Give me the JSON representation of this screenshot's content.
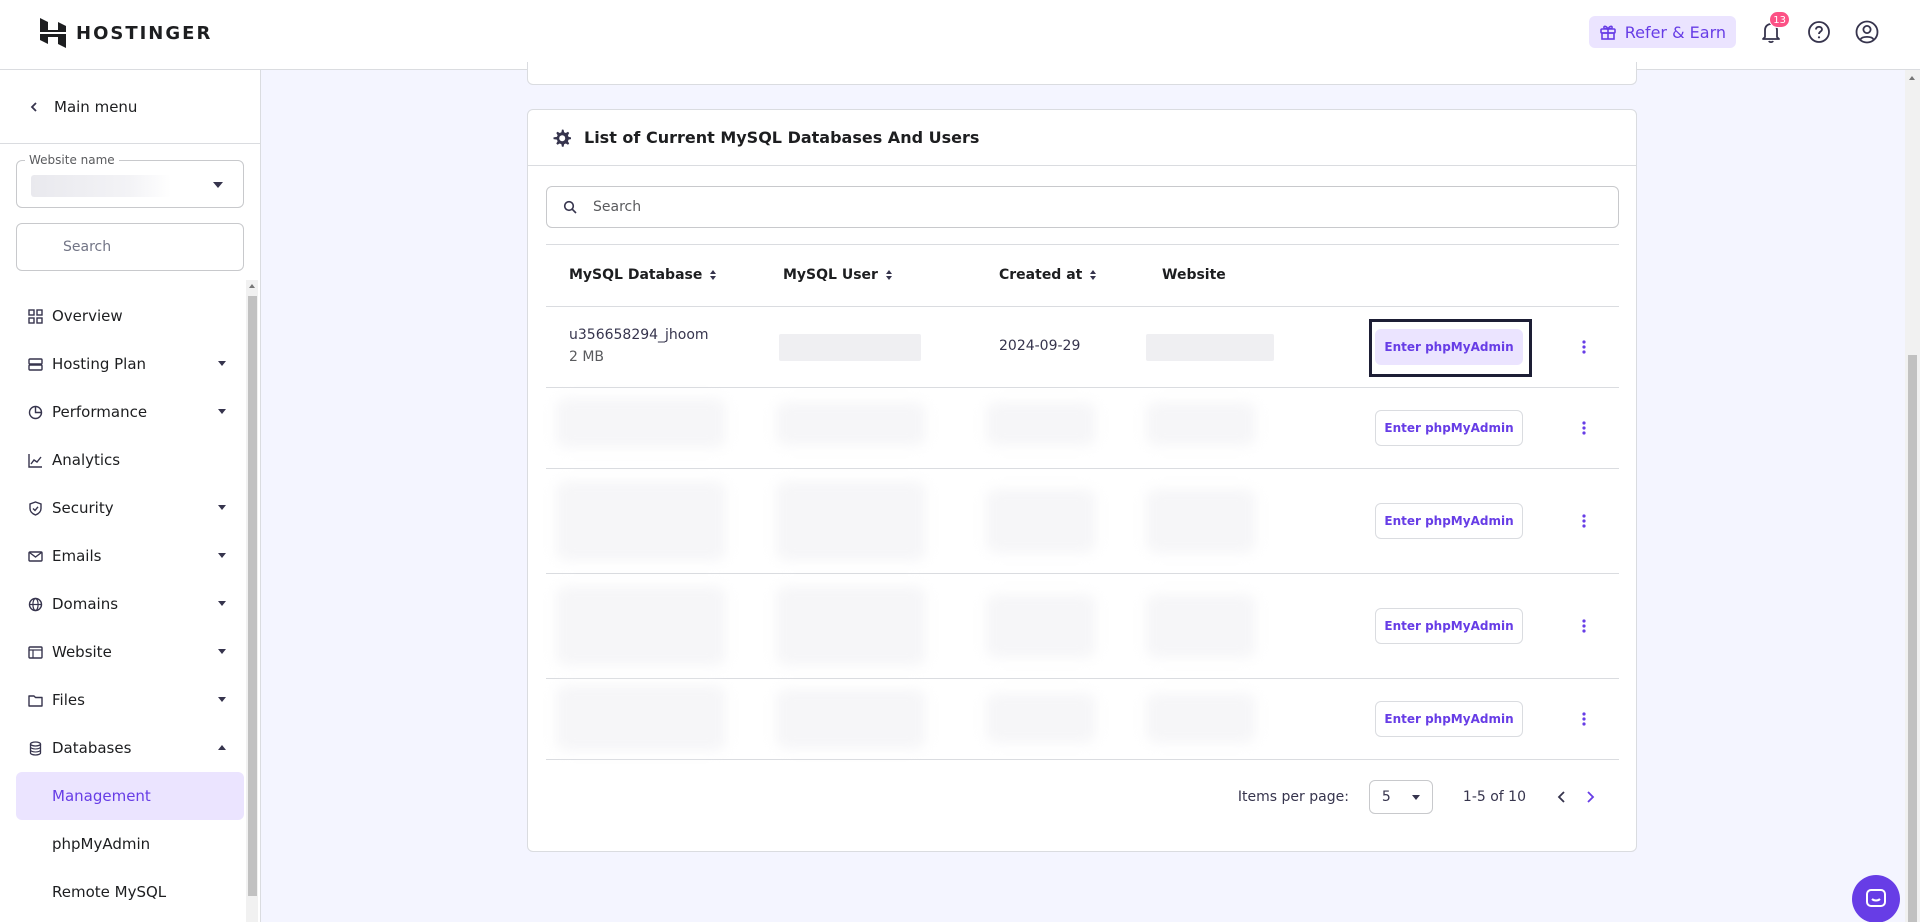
{
  "header": {
    "brand": "HOSTINGER",
    "refer_label": "Refer & Earn",
    "notifications_count": "13"
  },
  "sidebar": {
    "main_menu": "Main menu",
    "website_label": "Website name",
    "search_placeholder": "Search",
    "items": [
      {
        "label": "Overview",
        "icon": "grid-icon",
        "dropdown": false
      },
      {
        "label": "Hosting Plan",
        "icon": "server-icon",
        "dropdown": true
      },
      {
        "label": "Performance",
        "icon": "pie-chart-icon",
        "dropdown": true
      },
      {
        "label": "Analytics",
        "icon": "line-chart-icon",
        "dropdown": false
      },
      {
        "label": "Security",
        "icon": "shield-icon",
        "dropdown": true
      },
      {
        "label": "Emails",
        "icon": "mail-icon",
        "dropdown": true
      },
      {
        "label": "Domains",
        "icon": "globe-icon",
        "dropdown": true
      },
      {
        "label": "Website",
        "icon": "browser-icon",
        "dropdown": true
      },
      {
        "label": "Files",
        "icon": "folder-icon",
        "dropdown": true
      },
      {
        "label": "Databases",
        "icon": "database-icon",
        "dropdown": true,
        "expanded": true
      }
    ],
    "subitems": [
      {
        "label": "Management",
        "active": true
      },
      {
        "label": "phpMyAdmin",
        "active": false
      },
      {
        "label": "Remote MySQL",
        "active": false
      }
    ]
  },
  "card": {
    "title": "List of Current MySQL Databases And Users",
    "search_placeholder": "Search",
    "columns": {
      "db": "MySQL Database",
      "user": "MySQL User",
      "created": "Created at",
      "website": "Website"
    },
    "first_row": {
      "db_name": "u356658294_jhoom",
      "db_size": "2 MB",
      "created": "2024-09-29"
    },
    "action_label": "Enter phpMyAdmin",
    "pagination": {
      "items_per_page_label": "Items per page:",
      "items_per_page": "5",
      "range": "1-5 of 10"
    }
  },
  "colors": {
    "accent": "#673de6",
    "accent_light": "#ebe4ff",
    "badge": "#fc5185"
  }
}
